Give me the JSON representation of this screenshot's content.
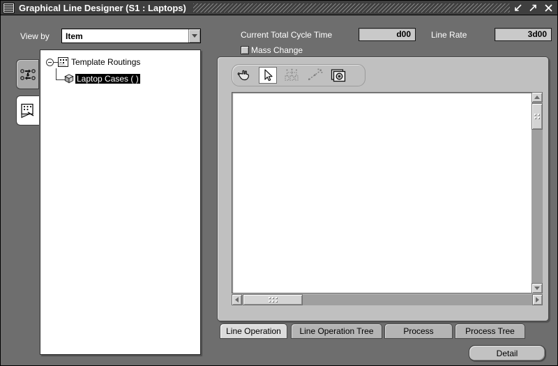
{
  "window": {
    "title": "Graphical Line Designer (S1 : Laptops)",
    "icon": "application-icon",
    "controls": [
      {
        "name": "minimize-button",
        "glyph": "minimize-arrow-icon"
      },
      {
        "name": "maximize-button",
        "glyph": "maximize-arrow-icon"
      },
      {
        "name": "close-button",
        "glyph": "close-x-icon"
      }
    ]
  },
  "header": {
    "view_by_label": "View by",
    "view_by_value": "Item",
    "view_by_options": [
      "Item"
    ],
    "cycle_time_label": "Current Total Cycle Time",
    "cycle_time_value": "d00",
    "line_rate_label": "Line Rate",
    "line_rate_value": "3d00",
    "mass_change_label": "Mass Change",
    "mass_change_checked": false
  },
  "side_tabs": [
    {
      "name": "sidebar-tab-routing",
      "icon": "flow-nodes-icon",
      "selected": false
    },
    {
      "name": "sidebar-tab-designer",
      "icon": "page-pencil-icon",
      "selected": true
    }
  ],
  "tree": {
    "root": {
      "label": "Template Routings",
      "icon": "routing-document-icon",
      "expanded": true
    },
    "children": [
      {
        "label": "Laptop Cases ( )",
        "icon": "cube-icon",
        "selected": true
      }
    ]
  },
  "toolbar": {
    "tools": [
      {
        "name": "pan-hand-tool",
        "icon": "hand-icon",
        "state": "enabled"
      },
      {
        "name": "select-tool",
        "icon": "arrow-pointer-icon",
        "state": "active"
      },
      {
        "name": "layout-tree-tool",
        "icon": "network-grid-icon",
        "state": "disabled"
      },
      {
        "name": "connect-tool",
        "icon": "connector-line-icon",
        "state": "disabled"
      },
      {
        "name": "zoom-camera-tool",
        "icon": "camera-icon",
        "state": "enabled"
      }
    ]
  },
  "canvas": {
    "content": "",
    "vscroll": {
      "name": "canvas-vertical-scrollbar"
    },
    "hscroll": {
      "name": "canvas-horizontal-scrollbar"
    }
  },
  "bottom_tabs": [
    {
      "name": "tab-line-operation",
      "label": "Line Operation",
      "selected": true
    },
    {
      "name": "tab-line-operation-tree",
      "label": "Line Operation Tree",
      "selected": false
    },
    {
      "name": "tab-process",
      "label": "Process",
      "selected": false
    },
    {
      "name": "tab-process-tree",
      "label": "Process Tree",
      "selected": false
    }
  ],
  "footer": {
    "detail_label": "Detail"
  },
  "colors": {
    "window_background": "#6e6e6e",
    "titlebar": "#3f3f3f",
    "panel": "#c0c0c0",
    "canvas": "#ffffff",
    "selection": "#000000"
  }
}
